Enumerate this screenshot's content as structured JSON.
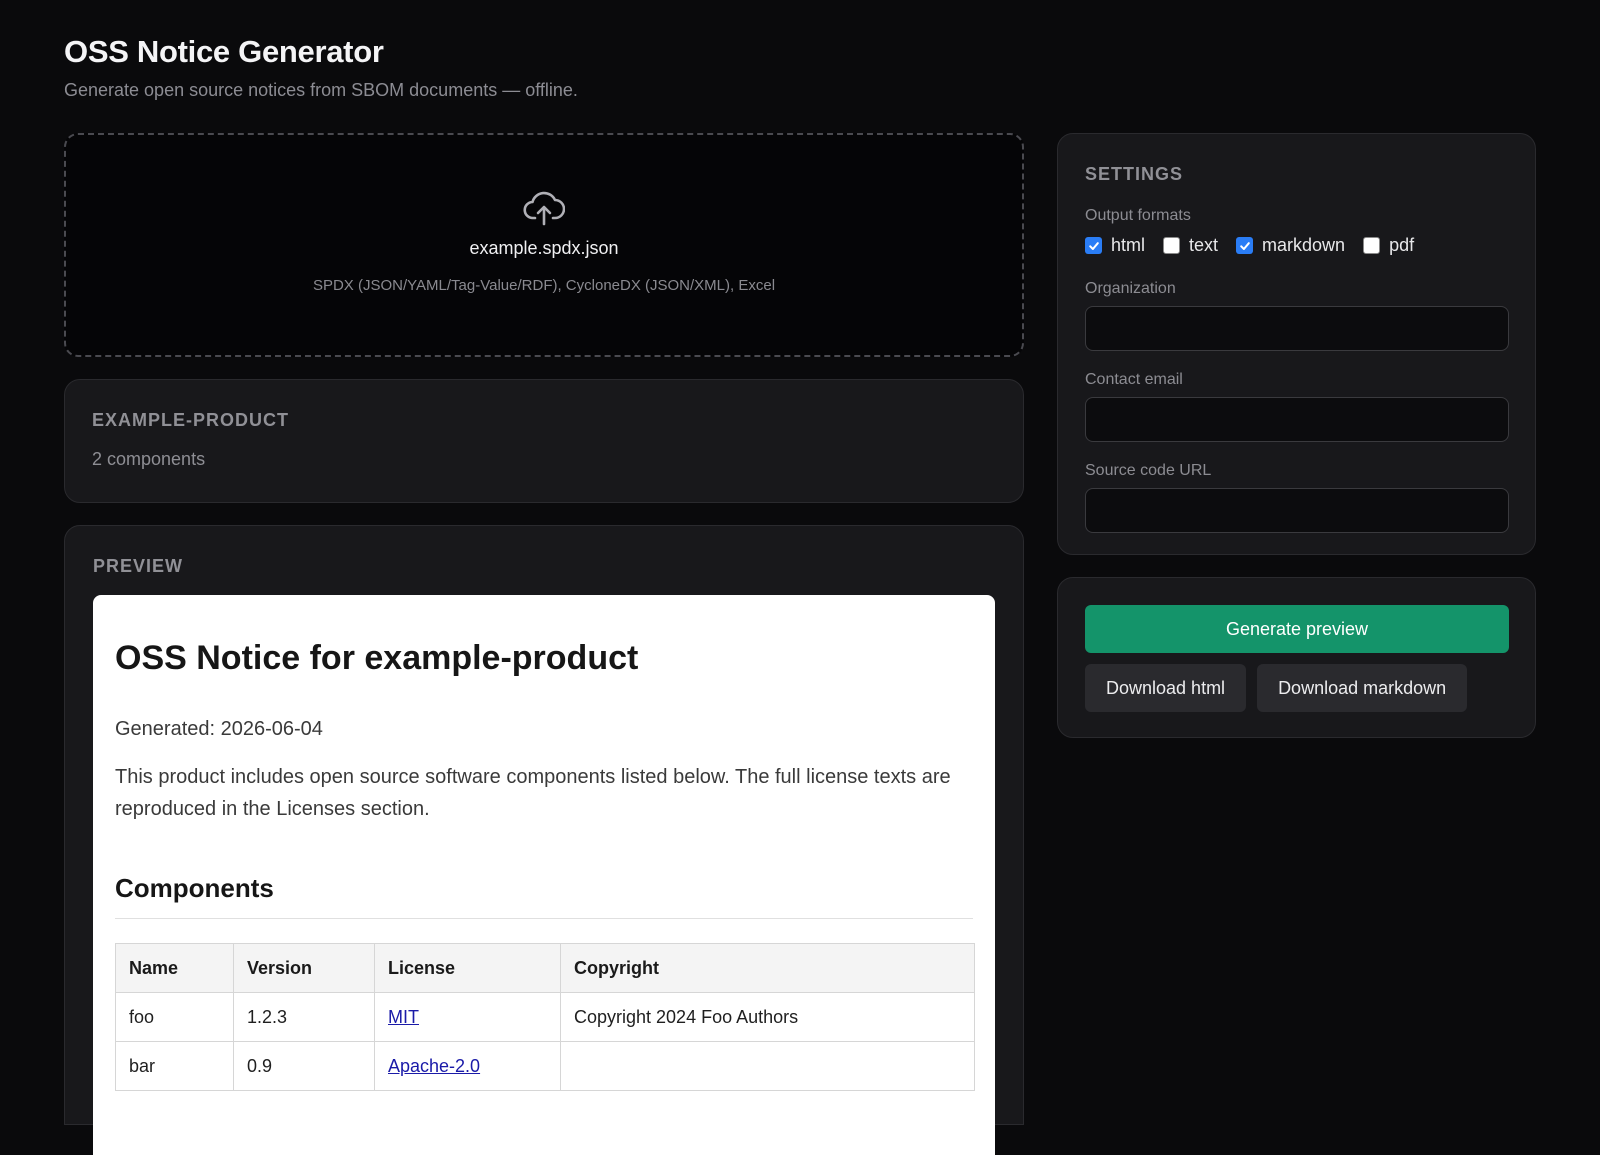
{
  "header": {
    "title": "OSS Notice Generator",
    "subtitle": "Generate open source notices from SBOM documents — offline."
  },
  "dropzone": {
    "icon": "cloud-upload-icon",
    "file_name": "example.spdx.json",
    "formats_hint": "SPDX (JSON/YAML/Tag-Value/RDF), CycloneDX (JSON/XML), Excel"
  },
  "product": {
    "name": "EXAMPLE-PRODUCT",
    "count": "2 components"
  },
  "preview": {
    "section_title": "PREVIEW",
    "doc": {
      "title": "OSS Notice for example-product",
      "generated": "Generated: 2026-06-04",
      "intro": "This product includes open source software components listed below. The full license texts are reproduced in the Licenses section.",
      "components_heading": "Components",
      "table": {
        "headers": [
          "Name",
          "Version",
          "License",
          "Copyright"
        ],
        "rows": [
          [
            "foo",
            "1.2.3",
            "MIT",
            "Copyright 2024 Foo Authors"
          ],
          [
            "bar",
            "0.9",
            "Apache-2.0",
            ""
          ]
        ]
      }
    }
  },
  "settings": {
    "section_title": "SETTINGS",
    "formats_label": "Output formats",
    "formats": [
      {
        "label": "html",
        "checked": true
      },
      {
        "label": "text",
        "checked": false
      },
      {
        "label": "markdown",
        "checked": true
      },
      {
        "label": "pdf",
        "checked": false
      }
    ],
    "organization_label": "Organization",
    "organization_value": "",
    "email_label": "Contact email",
    "email_value": "",
    "source_label": "Source code URL",
    "source_value": ""
  },
  "actions": {
    "generate_label": "Generate preview",
    "download_html_label": "Download html",
    "download_markdown_label": "Download markdown"
  },
  "colors": {
    "accent": "#14946a",
    "checkbox": "#2a7df6",
    "link": "#1a1aa8"
  }
}
